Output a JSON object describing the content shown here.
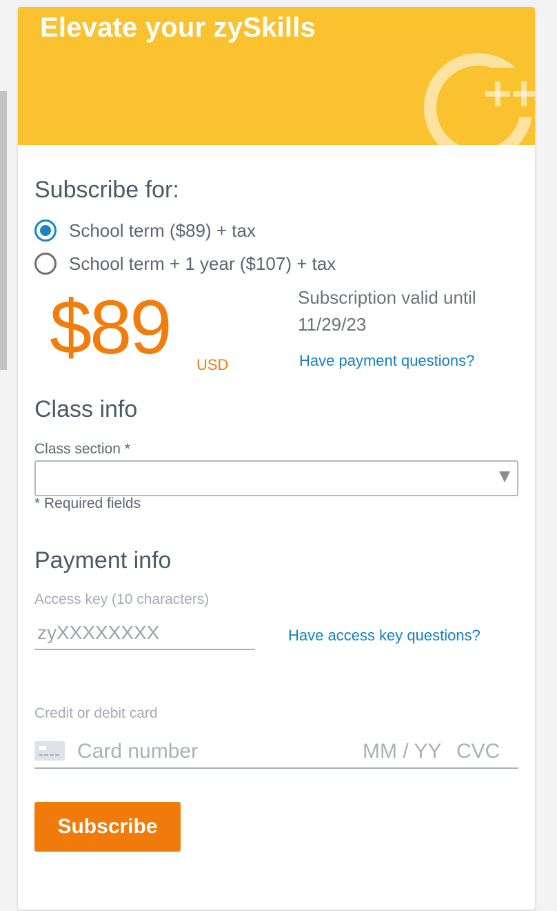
{
  "banner": {
    "title": "Elevate your zySkills",
    "logo_text": "C++",
    "color": "#fac22f"
  },
  "subscribe": {
    "heading": "Subscribe for:",
    "options": [
      {
        "label": "School term ($89) + tax",
        "selected": true
      },
      {
        "label": "School term + 1 year ($107) + tax",
        "selected": false
      }
    ]
  },
  "price": {
    "amount": "$89",
    "currency": "USD",
    "valid_text": "Subscription valid until 11/29/23",
    "payment_questions_link": "Have payment questions?"
  },
  "class_info": {
    "heading": "Class info",
    "section_label": "Class section *",
    "section_value": "",
    "required_note": "* Required fields"
  },
  "payment_info": {
    "heading": "Payment info",
    "access_key_label": "Access key (10 characters)",
    "access_key_placeholder": "zyXXXXXXXX",
    "access_key_link": "Have access key questions?",
    "card_label": "Credit or debit card",
    "card_number_placeholder": "Card number",
    "expiry_placeholder": "MM / YY",
    "cvc_placeholder": "CVC"
  },
  "actions": {
    "subscribe_label": "Subscribe"
  },
  "colors": {
    "accent": "#f07b0a",
    "link": "#1480c4",
    "radio_selected": "#1a84c7"
  }
}
